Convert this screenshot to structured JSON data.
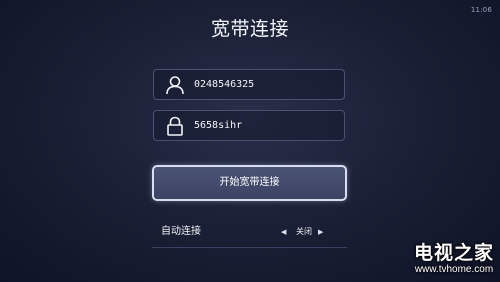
{
  "status_bar": {
    "time": "11:06"
  },
  "screen": {
    "title": "宽带连接"
  },
  "form": {
    "username": {
      "value": "0248546325",
      "icon": "user-icon"
    },
    "password": {
      "value": "5658sihr",
      "icon": "lock-icon"
    },
    "connect_button": {
      "label": "开始宽带连接"
    },
    "auto_connect": {
      "label": "自动连接",
      "value": "关闭",
      "left_arrow": "◀",
      "right_arrow": "▶"
    }
  },
  "watermark": {
    "title": "电视之家",
    "url": "www.tvhome.com"
  }
}
